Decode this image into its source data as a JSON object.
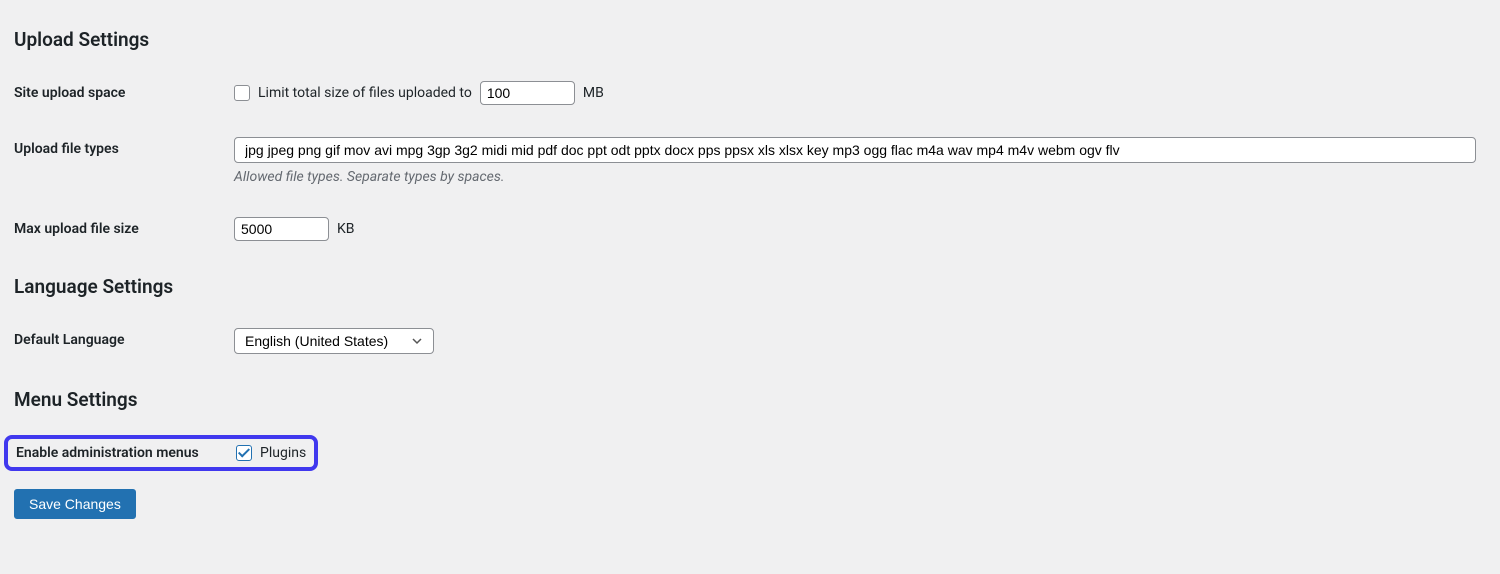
{
  "upload": {
    "heading": "Upload Settings",
    "site_upload_space": {
      "label": "Site upload space",
      "checkbox_text": "Limit total size of files uploaded to",
      "value": "100",
      "unit": "MB"
    },
    "file_types": {
      "label": "Upload file types",
      "value": "jpg jpeg png gif mov avi mpg 3gp 3g2 midi mid pdf doc ppt odt pptx docx pps ppsx xls xlsx key mp3 ogg flac m4a wav mp4 m4v webm ogv flv",
      "help": "Allowed file types. Separate types by spaces."
    },
    "max_size": {
      "label": "Max upload file size",
      "value": "5000",
      "unit": "KB"
    }
  },
  "language": {
    "heading": "Language Settings",
    "default_language": {
      "label": "Default Language",
      "selected": "English (United States)"
    }
  },
  "menu": {
    "heading": "Menu Settings",
    "enable_admin_menus": {
      "label": "Enable administration menus",
      "option": "Plugins"
    }
  },
  "actions": {
    "save": "Save Changes"
  }
}
